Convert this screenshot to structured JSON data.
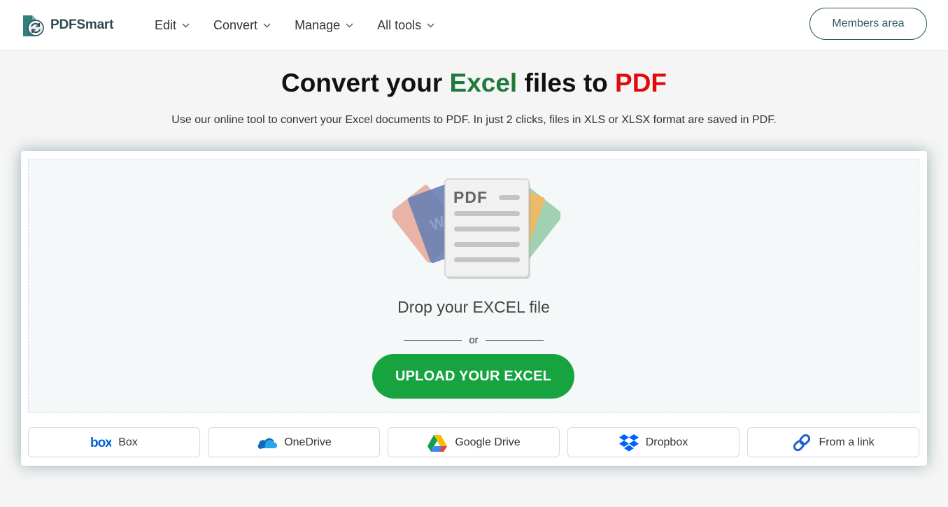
{
  "header": {
    "brand": "PDFSmart",
    "nav": [
      {
        "label": "Edit"
      },
      {
        "label": "Convert"
      },
      {
        "label": "Manage"
      },
      {
        "label": "All tools"
      }
    ],
    "members_label": "Members area"
  },
  "hero": {
    "title_part1": "Convert your ",
    "title_excel": "Excel",
    "title_part2": " files to ",
    "title_pdf": "PDF",
    "subtitle": "Use our online tool to convert your Excel documents to PDF. In just 2 clicks, files in XLS or XLSX format are saved in PDF."
  },
  "upload": {
    "illustration_label": "PDF",
    "drop_text": "Drop your EXCEL file",
    "or_text": "or",
    "button_label": "UPLOAD YOUR EXCEL"
  },
  "sources": [
    {
      "label": "Box",
      "icon": "box-icon"
    },
    {
      "label": "OneDrive",
      "icon": "onedrive-icon"
    },
    {
      "label": "Google Drive",
      "icon": "google-drive-icon"
    },
    {
      "label": "Dropbox",
      "icon": "dropbox-icon"
    },
    {
      "label": "From a link",
      "icon": "link-icon"
    }
  ],
  "colors": {
    "excel_green": "#1f7a3c",
    "pdf_red": "#e00c0c",
    "upload_green": "#17a340",
    "brand_teal": "#2c5866"
  }
}
